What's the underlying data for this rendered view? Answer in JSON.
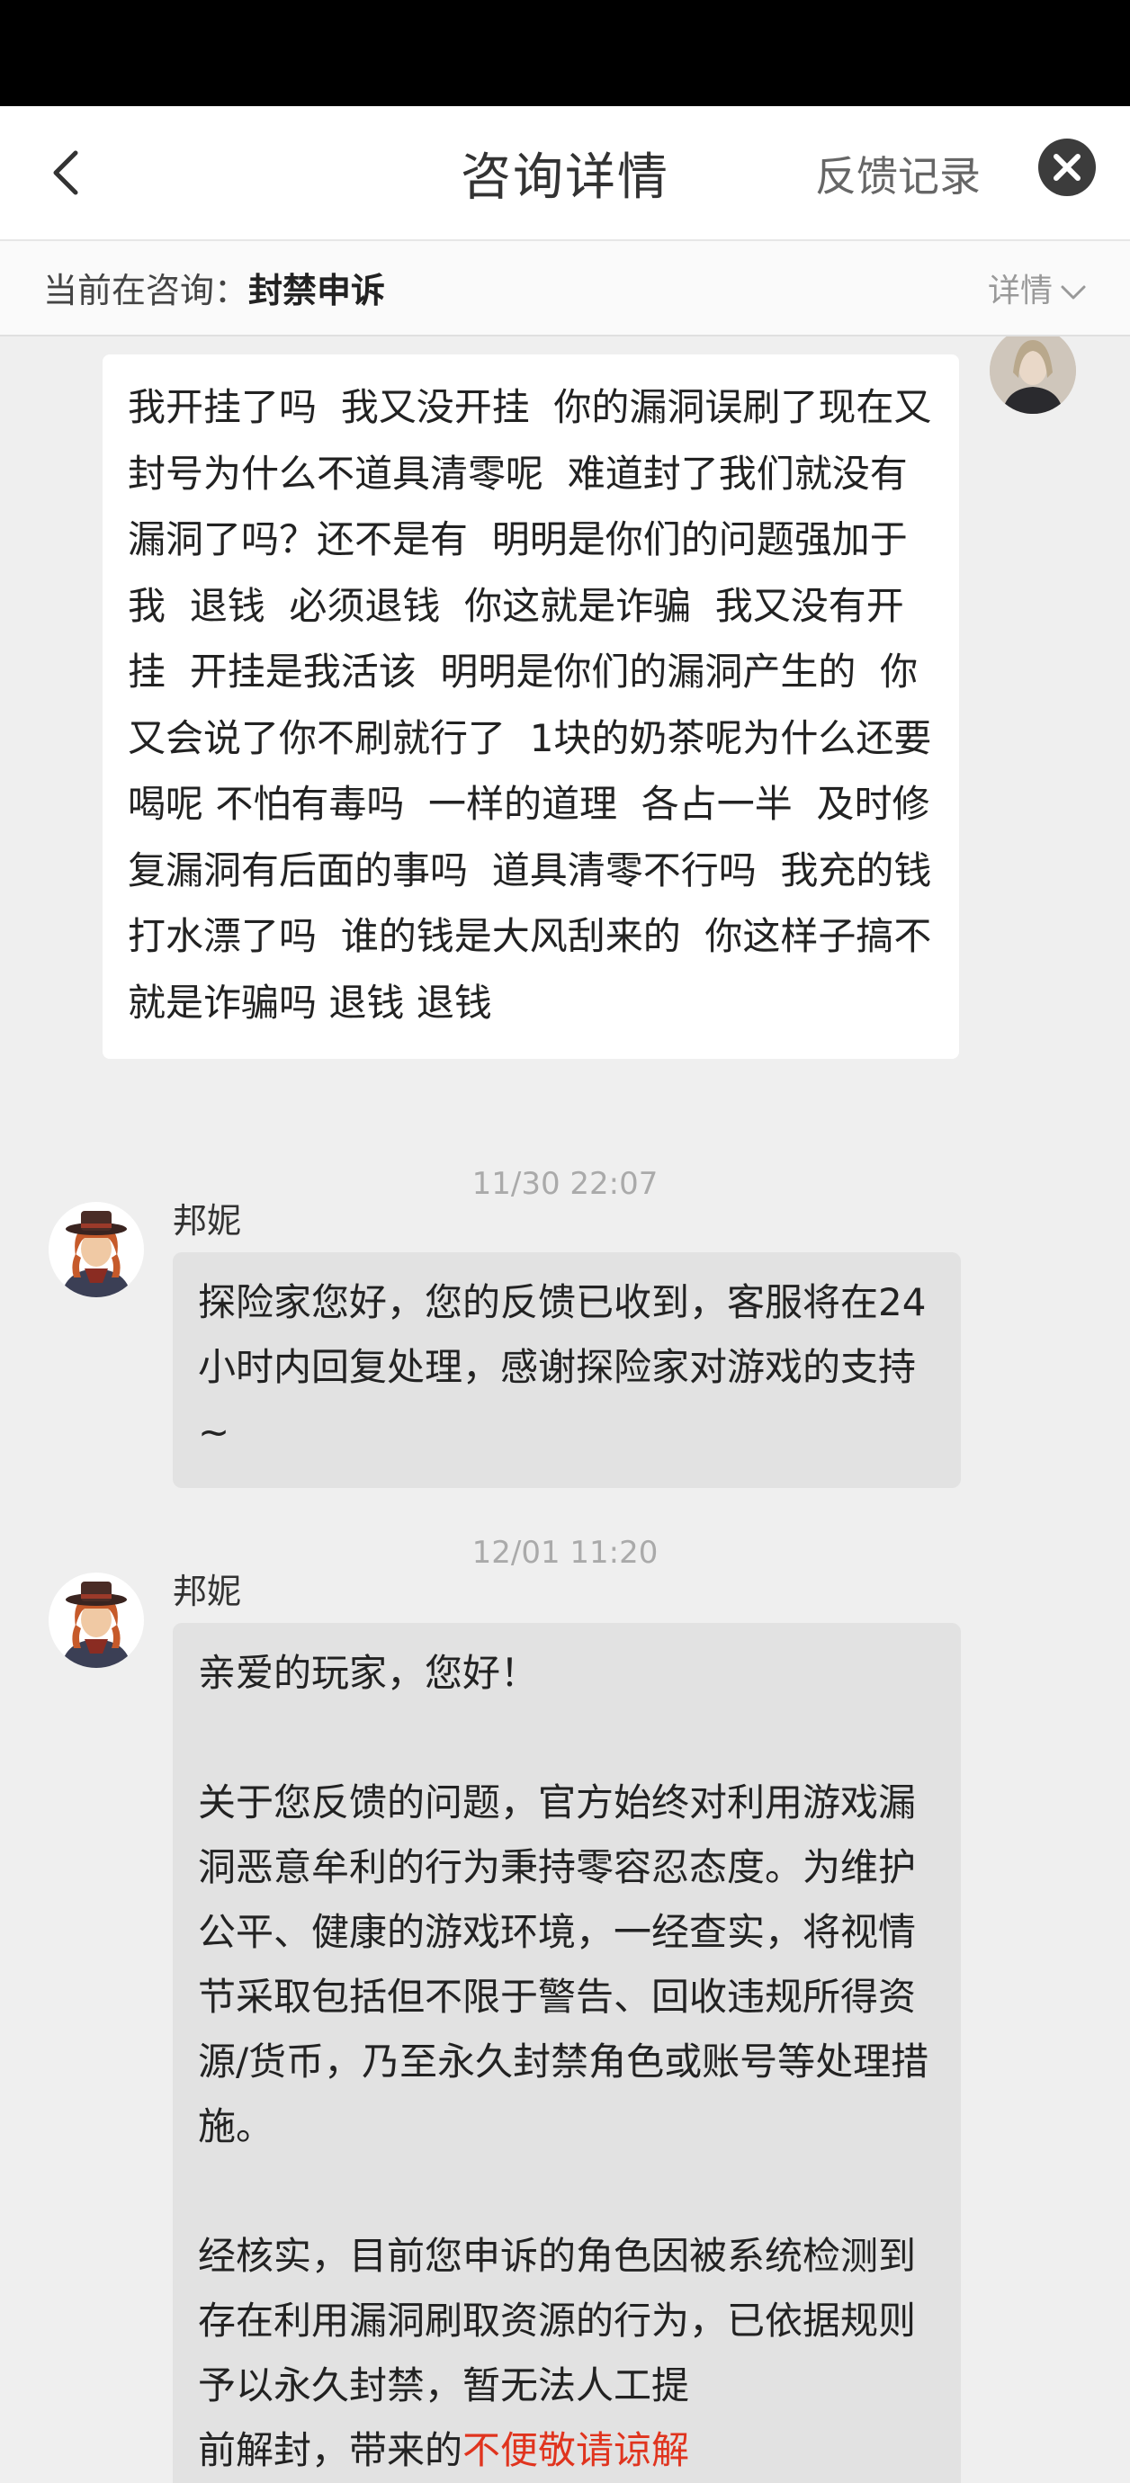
{
  "header": {
    "title": "咨询详情",
    "feedback_label": "反馈记录"
  },
  "consult": {
    "label": "当前在咨询：",
    "value": "封禁申诉",
    "details_label": "详情"
  },
  "messages": {
    "user_text": "我开挂了吗  我又没开挂  你的漏洞误刷了现在又封号为什么不道具清零呢  难道封了我们就没有漏洞了吗？还不是有  明明是你们的问题强加于我  退钱  必须退钱  你这就是诈骗  我又没有开挂  开挂是我活该  明明是你们的漏洞产生的  你又会说了你不刷就行了  1块的奶茶呢为什么还要喝呢 不怕有毒吗  一样的道理  各占一半  及时修复漏洞有后面的事吗  道具清零不行吗  我充的钱打水漂了吗  谁的钱是大风刮来的  你这样子搞不就是诈骗吗 退钱 退钱",
    "reply1": {
      "time": "11/30 22:07",
      "sender": "邦妮",
      "text": "探险家您好，您的反馈已收到，客服将在24小时内回复处理，感谢探险家对游戏的支持~"
    },
    "reply2": {
      "time": "12/01 11:20",
      "sender": "邦妮",
      "para1": "亲爱的玩家，您好！",
      "para2": "关于您反馈的问题，官方始终对利用游戏漏洞恶意牟利的行为秉持零容忍态度。为维护公平、健康的游戏环境，一经查实，将视情节采取包括但不限于警告、回收违规所得资源/货币，乃至永久封禁角色或账号等处理措施。",
      "para3": "经核实，目前您申诉的角色因被系统检测到存在利用漏洞刷取资源的行为，已依据规则予以永久封禁，暂无法人工提",
      "para4_start": "前解封，带来的",
      "para4_red": "不便敬请谅解"
    }
  },
  "colors": {
    "status_bar": "#000000",
    "user_bubble": "#ffffff",
    "agent_bubble": "#e2e2e2",
    "chat_background": "#efefef",
    "highlight_red": "#e0341e"
  },
  "icons": [
    "back-arrow-icon",
    "close-icon",
    "chevron-down-icon",
    "user-avatar-icon",
    "agent-avatar-icon"
  ]
}
